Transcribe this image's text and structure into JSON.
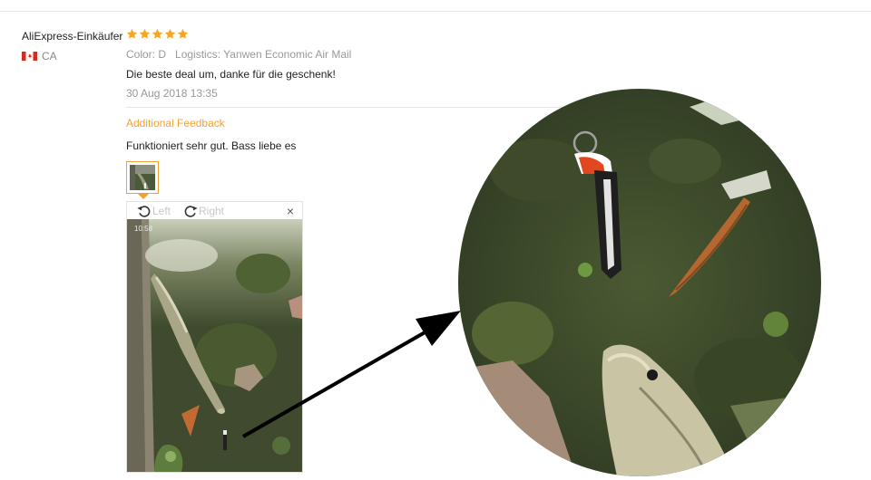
{
  "review": {
    "buyer_name": "AliExpress-Einkäufer",
    "rating": 5,
    "country_code": "CA",
    "color_label": "Color: D",
    "logistics_label": "Logistics: Yanwen Economic Air Mail",
    "text": "Die beste deal um, danke für die geschenk!",
    "date": "30 Aug 2018 13:35"
  },
  "additional_feedback": {
    "heading": "Additional Feedback",
    "text": "Funktioniert sehr gut. Bass liebe es"
  },
  "viewer": {
    "rotate_left_label": "Left",
    "rotate_right_label": "Right",
    "close_label": "×",
    "photo_timestamp": "10:58"
  },
  "colors": {
    "accent": "#f0a236",
    "star": "#f5a623",
    "muted_text": "#999999"
  }
}
